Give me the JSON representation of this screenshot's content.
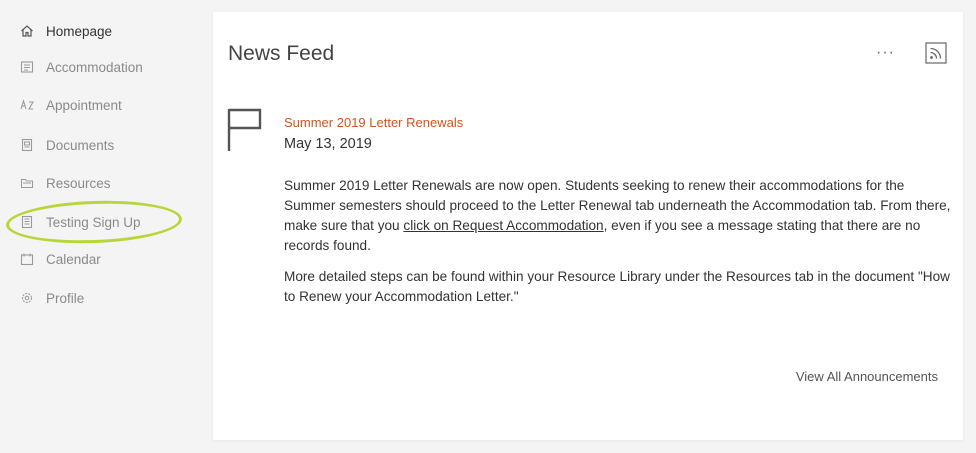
{
  "sidebar": {
    "items": [
      {
        "label": "Homepage",
        "icon": "home-icon"
      },
      {
        "label": "Accommodation",
        "icon": "list-icon"
      },
      {
        "label": "Appointment",
        "icon": "appointment-icon"
      },
      {
        "label": "Documents",
        "icon": "document-icon"
      },
      {
        "label": "Resources",
        "icon": "folder-icon"
      },
      {
        "label": "Testing Sign Up",
        "icon": "clipboard-icon"
      },
      {
        "label": "Calendar",
        "icon": "calendar-icon"
      },
      {
        "label": "Profile",
        "icon": "gear-icon"
      }
    ],
    "active": "Homepage",
    "highlight_color": "#b8d63a"
  },
  "news_feed": {
    "title": "News Feed",
    "more_label": "···",
    "announcement": {
      "title": "Summer 2019 Letter Renewals",
      "date": "May 13, 2019",
      "p1_before": "Summer 2019 Letter Renewals are now open. Students seeking to renew their accommodations for the Summer semesters should proceed to the Letter Renewal tab underneath the Accommodation tab. From there, make sure that you ",
      "p1_link": "click on Request Accommodation",
      "p1_after": ", even if you see a message stating that there are no records found.",
      "p2": "More detailed steps can be found within your Resource Library under the Resources tab in the document \"How to Renew your Accommodation Letter.\""
    },
    "view_all": "View All Announcements",
    "accent_color": "#d6521c"
  }
}
